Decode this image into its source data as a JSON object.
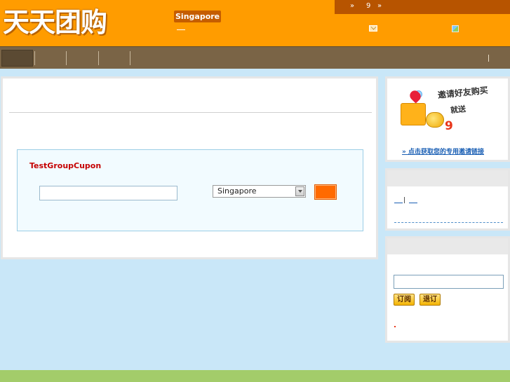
{
  "header": {
    "logo_text": "天天团购",
    "city": "Singapore",
    "topbar": {
      "left_arrow": "»",
      "count": "9",
      "right_arrow": "»"
    },
    "icons": [
      "mail-icon",
      "image-icon"
    ]
  },
  "search": {
    "title": "TestGroupCupon",
    "keyword_value": "",
    "city_selected": "Singapore"
  },
  "invite": {
    "title": "邀请好友购买",
    "subtitle": "就送",
    "amount": "9",
    "link_text": "» 点击获取您的专用邀请链接"
  },
  "links": {
    "separator": "|"
  },
  "subscribe": {
    "email_value": "",
    "subscribe_label": "订阅",
    "unsubscribe_label": "退订"
  },
  "colors": {
    "header_bg": "#ff9c00",
    "nav_bg": "#7a6446",
    "page_bg": "#c9e7f8",
    "accent_red": "#c50000",
    "search_button": "#ff6a00",
    "footer_bg": "#a3cc6a"
  }
}
